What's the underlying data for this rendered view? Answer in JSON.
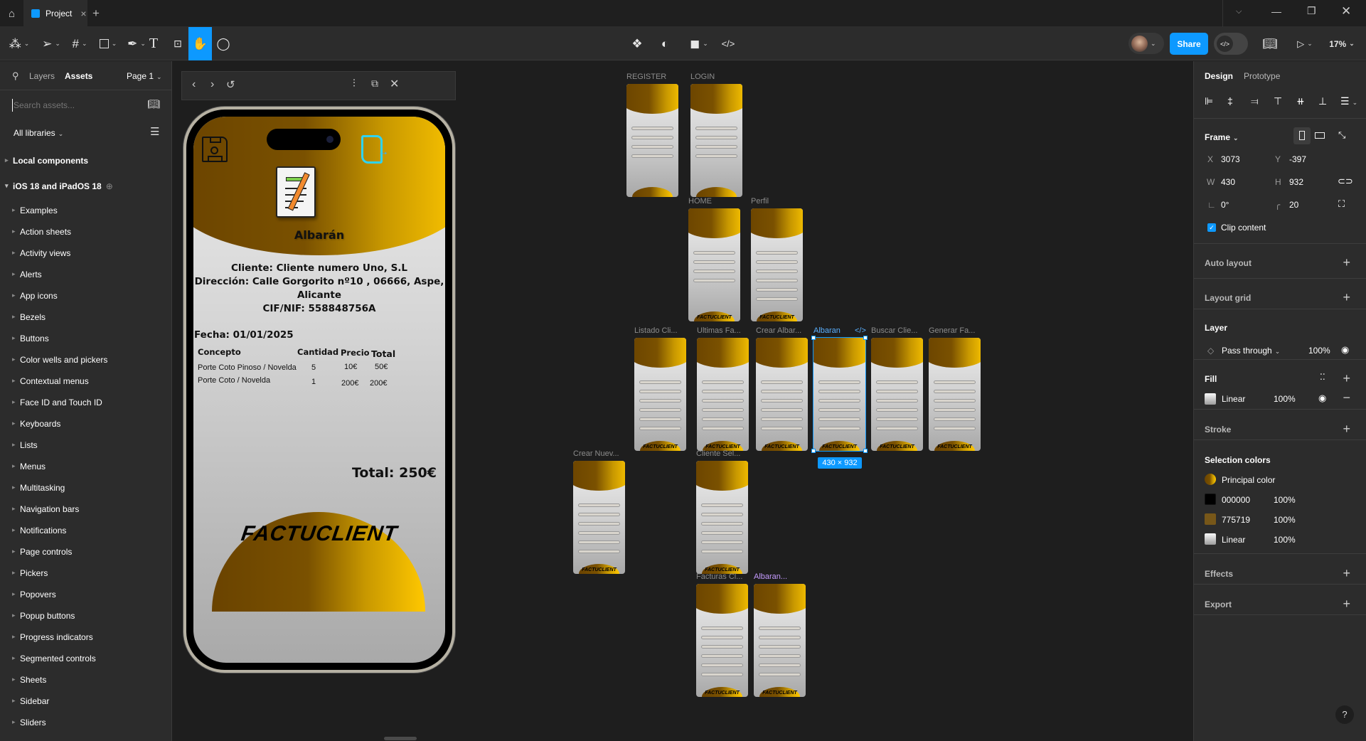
{
  "tabbar": {
    "tab_title": "Project",
    "home_icon": "home-icon",
    "close": "×",
    "new_tab": "+"
  },
  "toolbar": {
    "share_label": "Share",
    "zoom": "17%",
    "active_tool": "hand"
  },
  "left_panel": {
    "tabs": [
      "Layers",
      "Assets"
    ],
    "page": "Page 1",
    "search_placeholder": "Search assets...",
    "libraries": "All libraries",
    "local_components": "Local components",
    "library_name": "iOS 18 and iPadOS 18",
    "items": [
      "Examples",
      "Action sheets",
      "Activity views",
      "Alerts",
      "App icons",
      "Bezels",
      "Buttons",
      "Color wells and pickers",
      "Contextual menus",
      "Face ID and Touch ID",
      "Keyboards",
      "Lists",
      "Menus",
      "Multitasking",
      "Navigation bars",
      "Notifications",
      "Page controls",
      "Pickers",
      "Popovers",
      "Popup buttons",
      "Progress indicators",
      "Segmented controls",
      "Sheets",
      "Sidebar",
      "Sliders"
    ]
  },
  "phone": {
    "title": "Albarán",
    "client": "Cliente: Cliente numero Uno, S.L",
    "address1": "Dirección: Calle Gorgorito nº10 , 06666, Aspe,",
    "address2": "Alicante",
    "cif": "CIF/NIF: 558848756A",
    "date": "Fecha: 01/01/2025",
    "columns": [
      "Concepto",
      "Cantidad",
      "Precio",
      "Total"
    ],
    "rows": [
      [
        "Porte Coto Pinoso /  Novelda",
        "5",
        "10€",
        "50€"
      ],
      [
        "Porte Coto / Novelda",
        "1",
        "200€",
        "200€"
      ]
    ],
    "total": "Total: 250€",
    "brand": "FACTUCLIENT"
  },
  "canvas": {
    "frames": [
      "REGISTER",
      "LOGIN",
      "HOME",
      "Perfil",
      "Listado Cli...",
      "Ultimas Fa...",
      "Crear Albar...",
      "Albaran",
      "Buscar Clie...",
      "Generar Fa...",
      "Crear Nuev...",
      "Cliente Sel...",
      "Facturas Cl...",
      "Albaran..."
    ],
    "thumb_brand": "FACTUCLIENT",
    "selected_frame": "Albaran",
    "size_badge": "430 × 932"
  },
  "right_panel": {
    "tabs": [
      "Design",
      "Prototype"
    ],
    "frame_label": "Frame",
    "x": "3073",
    "y": "-397",
    "w": "430",
    "h": "932",
    "rotation": "0°",
    "radius": "20",
    "clip_content": "Clip content",
    "clip_checked": true,
    "auto_layout": "Auto layout",
    "layout_grid": "Layout grid",
    "layer": "Layer",
    "blend": "Pass through",
    "layer_opacity": "100%",
    "fill": "Fill",
    "fill_type": "Linear",
    "fill_opacity": "100%",
    "stroke": "Stroke",
    "selection_colors": "Selection colors",
    "colors": [
      {
        "name": "Principal color",
        "opacity": ""
      },
      {
        "name": "000000",
        "opacity": "100%",
        "hex": "#000000"
      },
      {
        "name": "775719",
        "opacity": "100%",
        "hex": "#775719"
      },
      {
        "name": "Linear",
        "opacity": "100%"
      }
    ],
    "effects": "Effects",
    "export": "Export"
  },
  "colors": {
    "accent": "#0d99ff",
    "gold_dark": "#775719",
    "gold_light": "#ffc800"
  }
}
